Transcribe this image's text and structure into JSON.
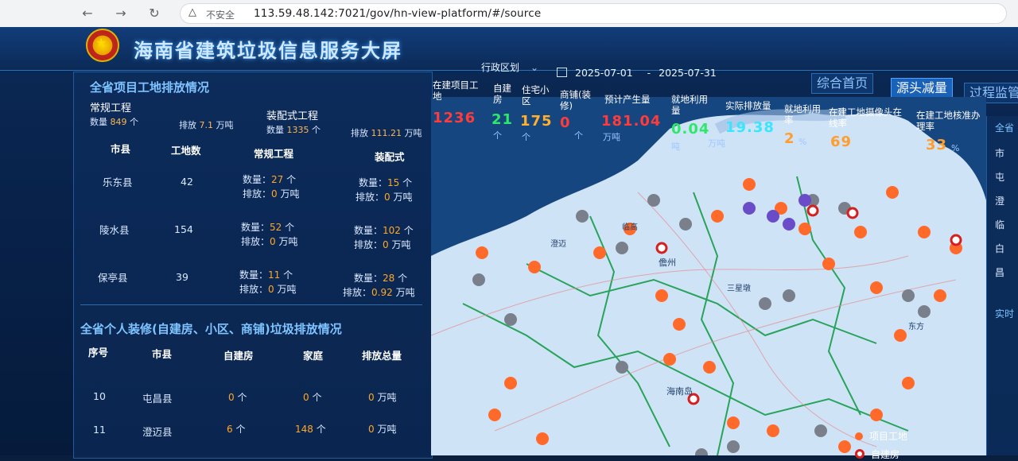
{
  "browser": {
    "back": "←",
    "forward": "→",
    "reload": "↻",
    "warning_icon": "△",
    "not_secure": "不安全",
    "url": "113.59.48.142:7021/gov/hn-view-platform/#/source"
  },
  "header": {
    "title": "海南省建筑垃圾信息服务大屏",
    "region_select": "行政区划",
    "date_start": "2025-07-01",
    "date_sep": "-",
    "date_end": "2025-07-31",
    "tabs": [
      "综合首页",
      "源头减量",
      "过程监管"
    ],
    "active_tab": "源头减量"
  },
  "left_panel": {
    "section1_title": "全省项目工地排放情况",
    "regular": {
      "title": "常规工程",
      "count_label": "数量",
      "count_value": "849",
      "count_unit": "个",
      "emission_label": "排放",
      "emission_value": "7.1",
      "emission_unit": "万吨"
    },
    "prefab": {
      "title": "装配式工程",
      "count_label": "数量",
      "count_value": "1335",
      "count_unit": "个",
      "emission_label": "排放",
      "emission_value": "111.21",
      "emission_unit": "万吨"
    },
    "table1_headers": [
      "市县",
      "工地数",
      "常规工程",
      "装配式"
    ],
    "table1_rows": [
      {
        "county": "乐东县",
        "sites": "42",
        "reg_count": "27",
        "reg_emit": "0",
        "pre_count": "15",
        "pre_emit": "0"
      },
      {
        "county": "陵水县",
        "sites": "154",
        "reg_count": "52",
        "reg_emit": "0",
        "pre_count": "102",
        "pre_emit": "0"
      },
      {
        "county": "保亭县",
        "sites": "39",
        "reg_count": "11",
        "reg_emit": "0",
        "pre_count": "28",
        "pre_emit": "0.92"
      }
    ],
    "labels": {
      "count": "数量：",
      "emit": "排放：",
      "unit_ge": "个",
      "unit_wandun": "万吨"
    },
    "section2_title": "全省个人装修(自建房、小区、商铺)垃圾排放情况",
    "table2_headers": [
      "序号",
      "市县",
      "自建房",
      "家庭",
      "排放总量"
    ],
    "table2_rows": [
      {
        "no": "10",
        "county": "屯昌县",
        "self_built": "0",
        "family": "0",
        "total": "0"
      },
      {
        "no": "11",
        "county": "澄迈县",
        "self_built": "6",
        "family": "148",
        "total": "0"
      }
    ]
  },
  "stats": [
    {
      "label1": "在建项目工",
      "label2": "地",
      "value": "1236",
      "unit": "",
      "color": "#ff3b3b"
    },
    {
      "label1": "自建",
      "label2": "房",
      "value": "21",
      "unit": "个",
      "color": "#2ee86a"
    },
    {
      "label1": "住宅小",
      "label2": "区",
      "value": "175",
      "unit": "个",
      "color": "#ffb02e"
    },
    {
      "label1": "商铺(装",
      "label2": "修)",
      "value": "0",
      "unit": "个",
      "color": "#ff3b3b"
    },
    {
      "label1": "预计产生量",
      "label2": "",
      "value": "181.04",
      "unit": "万吨",
      "color": "#ff3b3b"
    },
    {
      "label1": "就地利用",
      "label2": "量",
      "value": "0.04",
      "unit": "吨",
      "color": "#2ee86a"
    },
    {
      "label1": "实际排放量",
      "label2": "",
      "value": "19.38",
      "unit": "万吨",
      "color": "#38e6ff"
    },
    {
      "label1": "就地利用",
      "label2": "率",
      "value": "2",
      "unit": "%",
      "color": "#ff9d2e"
    },
    {
      "label1": "在建工地摄像头在",
      "label2": "线率",
      "value": "69",
      "unit": "",
      "color": "#ff9d2e"
    },
    {
      "label1": "在建工地核准办",
      "label2": "理率",
      "value": "33",
      "unit": "%",
      "color": "#ff9d2e"
    }
  ],
  "map_labels": [
    "儋州",
    "三星墩",
    "海南岛",
    "临高",
    "澄迈",
    "东方"
  ],
  "legend": {
    "item1": "项目工地",
    "item2": "自建房"
  },
  "right_strip": [
    "全省",
    "市",
    "屯",
    "澄",
    "临",
    "白",
    "昌",
    "实时"
  ]
}
